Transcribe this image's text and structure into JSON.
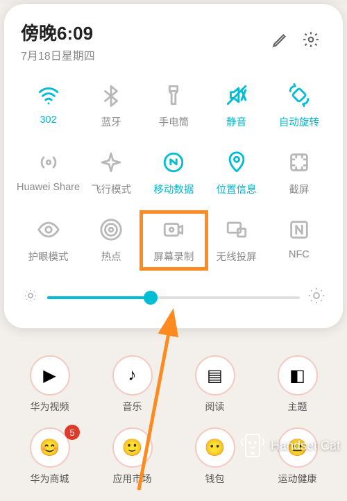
{
  "header": {
    "time": "傍晚6:09",
    "date": "7月18日星期四"
  },
  "tiles": [
    {
      "label": "302",
      "name": "wifi",
      "active": true
    },
    {
      "label": "蓝牙",
      "name": "bluetooth",
      "active": false
    },
    {
      "label": "手电筒",
      "name": "flashlight",
      "active": false
    },
    {
      "label": "静音",
      "name": "mute",
      "active": true
    },
    {
      "label": "自动旋转",
      "name": "auto-rotate",
      "active": true
    },
    {
      "label": "Huawei Share",
      "name": "huawei-share",
      "active": false
    },
    {
      "label": "飞行模式",
      "name": "airplane-mode",
      "active": false
    },
    {
      "label": "移动数据",
      "name": "mobile-data",
      "active": true
    },
    {
      "label": "位置信息",
      "name": "location",
      "active": true
    },
    {
      "label": "截屏",
      "name": "screenshot",
      "active": false
    },
    {
      "label": "护眼模式",
      "name": "eye-comfort",
      "active": false
    },
    {
      "label": "热点",
      "name": "hotspot",
      "active": false
    },
    {
      "label": "屏幕录制",
      "name": "screen-record",
      "active": false
    },
    {
      "label": "无线投屏",
      "name": "wireless-projection",
      "active": false
    },
    {
      "label": "NFC",
      "name": "nfc",
      "active": false
    }
  ],
  "brightness": {
    "percent": 41
  },
  "home_apps": [
    {
      "label": "华为视频",
      "emoji": "▶",
      "badge": null
    },
    {
      "label": "音乐",
      "emoji": "♪",
      "badge": null
    },
    {
      "label": "阅读",
      "emoji": "▤",
      "badge": null
    },
    {
      "label": "主题",
      "emoji": "◧",
      "badge": null
    },
    {
      "label": "华为商城",
      "emoji": "😊",
      "badge": "5"
    },
    {
      "label": "应用市场",
      "emoji": "🙂",
      "badge": null
    },
    {
      "label": "钱包",
      "emoji": "😶",
      "badge": null
    },
    {
      "label": "运动健康",
      "emoji": "😐",
      "badge": null
    }
  ],
  "highlight_index": 12,
  "watermark": "Handset Cat"
}
